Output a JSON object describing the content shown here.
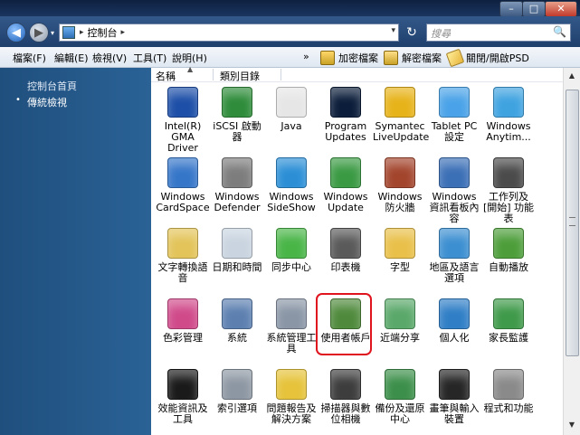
{
  "window": {
    "minimize_label": "–",
    "maximize_label": "□",
    "close_label": "✕"
  },
  "address": {
    "separator": "▸",
    "path": "控制台",
    "dropdown": "▾",
    "refresh": "↻",
    "search_placeholder": "搜尋",
    "search_icon": "🔍"
  },
  "menu": {
    "file": "檔案(F)",
    "edit": "編輯(E)",
    "view": "檢視(V)",
    "tools": "工具(T)",
    "help": "說明(H)",
    "more": "»"
  },
  "toolbar": {
    "encrypt": "加密檔案",
    "decrypt": "解密檔案",
    "psd": "關閉/開啟PSD"
  },
  "sidebar": {
    "home": "控制台首頁",
    "bullet": "•",
    "classic": "傳統檢視"
  },
  "columns": {
    "name": "名稱",
    "category": "類別目錄",
    "sort_arrow": "▲"
  },
  "items": [
    {
      "label": "Intel(R) GMA Driver",
      "color": "#1d4fa8"
    },
    {
      "label": "iSCSI 啟動器",
      "color": "#2e8c3a"
    },
    {
      "label": "Java",
      "color": "#e6e6e6"
    },
    {
      "label": "Program Updates",
      "color": "#0b1d3a"
    },
    {
      "label": "Symantec LiveUpdate",
      "color": "#e7b31a"
    },
    {
      "label": "Tablet PC 設定",
      "color": "#4aa3e8"
    },
    {
      "label": "Windows Anytim...",
      "color": "#3fa3e0"
    },
    {
      "label": "Windows CardSpace",
      "color": "#3676c9"
    },
    {
      "label": "Windows Defender",
      "color": "#7d7d7d"
    },
    {
      "label": "Windows SideShow",
      "color": "#2c8fd6"
    },
    {
      "label": "Windows Update",
      "color": "#3a9a43"
    },
    {
      "label": "Windows 防火牆",
      "color": "#a3452d"
    },
    {
      "label": "Windows 資訊看板內容",
      "color": "#3b6fb6"
    },
    {
      "label": "工作列及 [開始] 功能表",
      "color": "#4b4b4b"
    },
    {
      "label": "文字轉換語音",
      "color": "#e3c45a"
    },
    {
      "label": "日期和時間",
      "color": "#c9d4e0"
    },
    {
      "label": "同步中心",
      "color": "#49b547"
    },
    {
      "label": "印表機",
      "color": "#5a5a5a"
    },
    {
      "label": "字型",
      "color": "#e9c04a"
    },
    {
      "label": "地區及語言選項",
      "color": "#3c8fd1"
    },
    {
      "label": "自動播放",
      "color": "#4d9e3a"
    },
    {
      "label": "色彩管理",
      "color": "#d04a8a"
    },
    {
      "label": "系統",
      "color": "#5c7fb0"
    },
    {
      "label": "系統管理工具",
      "color": "#8a96a6"
    },
    {
      "label": "使用者帳戶",
      "color": "#4f8a3c"
    },
    {
      "label": "近端分享",
      "color": "#5aa86a"
    },
    {
      "label": "個人化",
      "color": "#2f7ec6"
    },
    {
      "label": "家長監護",
      "color": "#3f9a4a"
    },
    {
      "label": "效能資訊及工具",
      "color": "#1a1a1a"
    },
    {
      "label": "索引選項",
      "color": "#8d97a3"
    },
    {
      "label": "問題報告及解決方案",
      "color": "#e6c33a"
    },
    {
      "label": "掃描器與數位相機",
      "color": "#3d3d3d"
    },
    {
      "label": "備份及還原中心",
      "color": "#3c8f4a"
    },
    {
      "label": "畫筆與輸入裝置",
      "color": "#262626"
    },
    {
      "label": "程式和功能",
      "color": "#8a8a8a"
    }
  ],
  "scrollbar": {
    "up": "▲",
    "down": "▼"
  }
}
